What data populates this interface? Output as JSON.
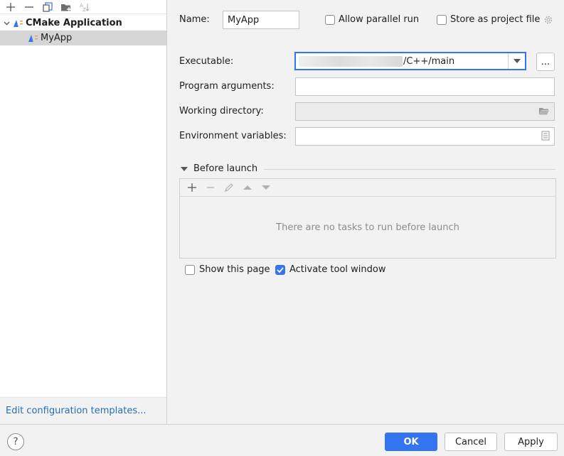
{
  "left_toolbar": {
    "icons": [
      "add-icon",
      "remove-icon",
      "copy-icon",
      "folder-add-icon",
      "sort-alpha-icon"
    ]
  },
  "tree": {
    "group_label": "CMake Application",
    "item_label": "MyApp"
  },
  "left_footer": {
    "link_label": "Edit configuration templates..."
  },
  "name": {
    "label": "Name:",
    "value": "MyApp"
  },
  "options": {
    "allow_parallel": "Allow parallel run",
    "store_project": "Store as project file"
  },
  "executable": {
    "label": "Executable:",
    "value_suffix": "/C++/main",
    "browse_label": "..."
  },
  "program_arguments": {
    "label": "Program arguments:",
    "value": ""
  },
  "working_directory": {
    "label": "Working directory:",
    "value": ""
  },
  "environment_variables": {
    "label": "Environment variables:",
    "value": ""
  },
  "before_launch": {
    "title": "Before launch",
    "empty_text": "There are no tasks to run before launch"
  },
  "bottom_options": {
    "show_page": "Show this page",
    "show_page_checked": false,
    "activate_tool": "Activate tool window",
    "activate_tool_checked": true
  },
  "footer": {
    "help": "?",
    "ok": "OK",
    "cancel": "Cancel",
    "apply": "Apply"
  },
  "colors": {
    "accent": "#3574f0",
    "link": "#2470b3"
  }
}
